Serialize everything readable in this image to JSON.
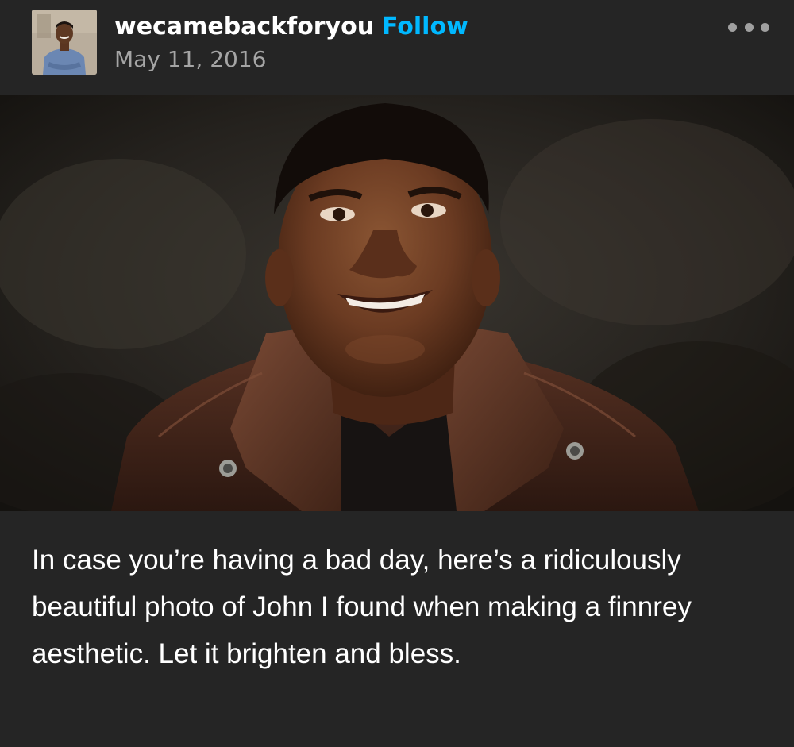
{
  "post": {
    "author": {
      "username": "wecamebackforyou",
      "avatar_icon": "avatar-photo"
    },
    "follow_label": "Follow",
    "date": "May 11, 2016",
    "more_icon": "ellipsis-icon",
    "photo": {
      "subject": "portrait-photo"
    },
    "caption": "In case you’re having a bad day, here’s a ridiculously beautiful photo of John I found when making a finnrey aesthetic. Let it brighten and bless."
  },
  "colors": {
    "background": "#252525",
    "username": "#ffffff",
    "follow": "#00b8ff",
    "date": "#a5a5a5",
    "caption": "#ffffff"
  }
}
